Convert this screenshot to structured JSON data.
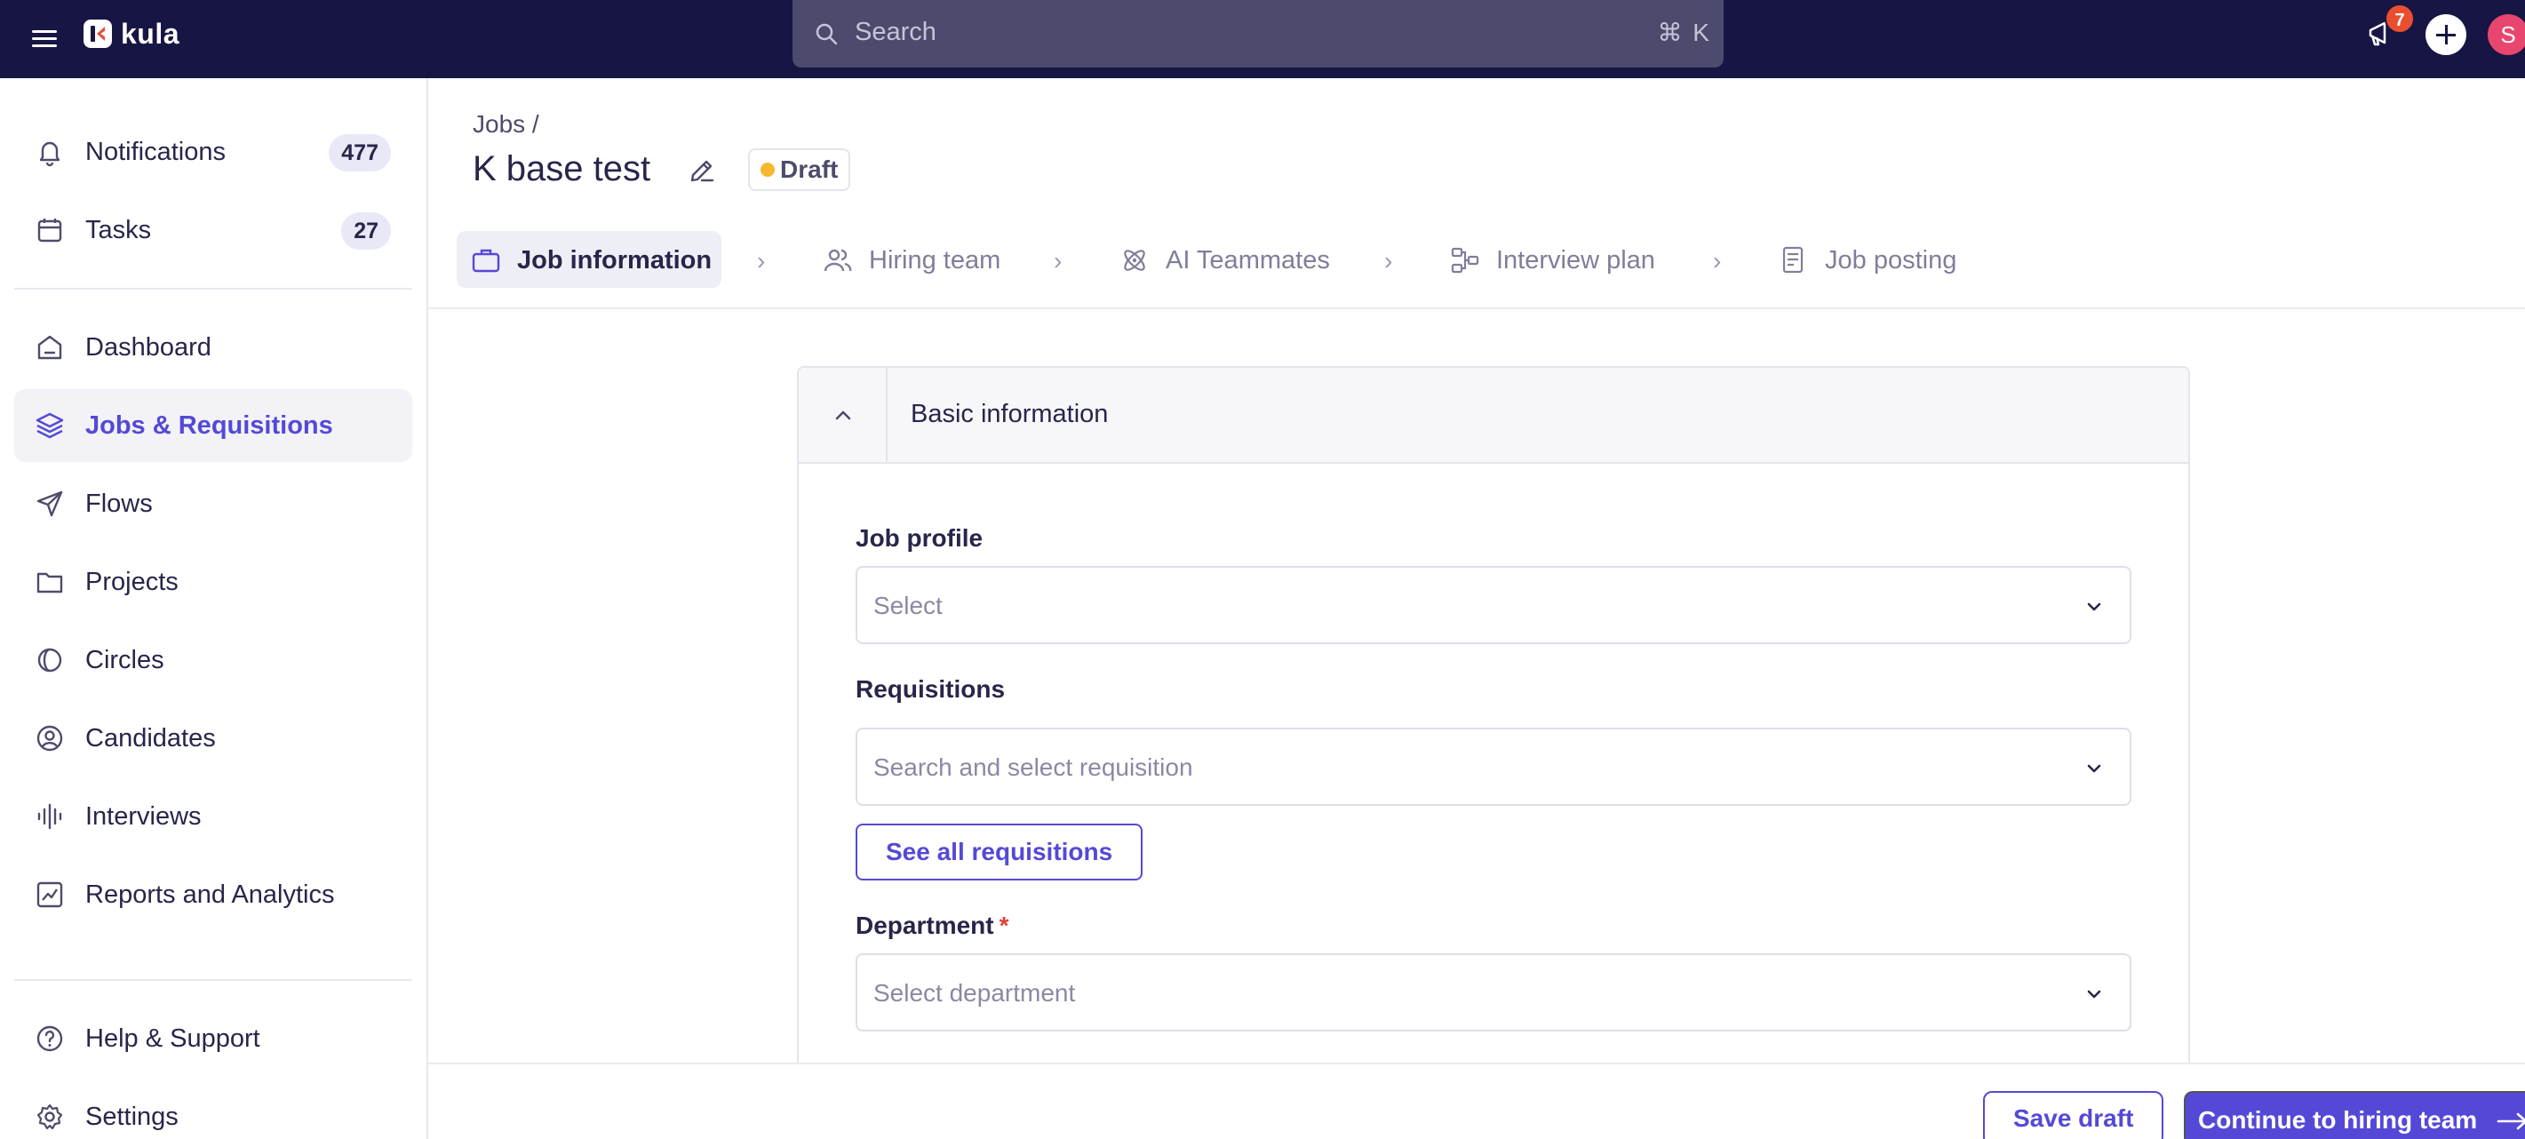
{
  "app": {
    "name": "kula"
  },
  "search": {
    "placeholder": "Search",
    "shortcut": "⌘ K"
  },
  "topbar": {
    "notification_badge": "7",
    "avatar_initial": "S"
  },
  "sidebar": {
    "items": [
      {
        "label": "Notifications",
        "count": "477",
        "icon": "bell-icon"
      },
      {
        "label": "Tasks",
        "count": "27",
        "icon": "calendar-icon"
      },
      {
        "label": "Dashboard",
        "icon": "home-icon"
      },
      {
        "label": "Jobs & Requisitions",
        "icon": "layers-icon",
        "active": true
      },
      {
        "label": "Flows",
        "icon": "send-icon"
      },
      {
        "label": "Projects",
        "icon": "folder-icon"
      },
      {
        "label": "Circles",
        "icon": "circles-icon"
      },
      {
        "label": "Candidates",
        "icon": "user-circle-icon"
      },
      {
        "label": "Interviews",
        "icon": "audio-wave-icon"
      },
      {
        "label": "Reports and Analytics",
        "icon": "chart-icon"
      },
      {
        "label": "Help & Support",
        "icon": "help-icon"
      },
      {
        "label": "Settings",
        "icon": "gear-icon"
      }
    ]
  },
  "page": {
    "breadcrumb": "Jobs /",
    "title": "K base test",
    "status": "Draft"
  },
  "steps": [
    {
      "label": "Job information",
      "icon": "briefcase-icon",
      "active": true
    },
    {
      "label": "Hiring team",
      "icon": "users-icon"
    },
    {
      "label": "AI Teammates",
      "icon": "atom-icon"
    },
    {
      "label": "Interview plan",
      "icon": "flow-icon"
    },
    {
      "label": "Job posting",
      "icon": "document-icon"
    }
  ],
  "card": {
    "title": "Basic information",
    "job_profile": {
      "label": "Job profile",
      "placeholder": "Select"
    },
    "requisitions": {
      "label": "Requisitions",
      "placeholder": "Search and select requisition",
      "see_all": "See all requisitions"
    },
    "department": {
      "label": "Department",
      "required_mark": "*",
      "placeholder": "Select department"
    }
  },
  "footer": {
    "save_draft": "Save draft",
    "continue": "Continue to hiring team"
  },
  "colors": {
    "accent": "#5449d6",
    "topbar": "#171544",
    "draft_dot": "#f5b82e",
    "badge": "#e94e2f"
  }
}
